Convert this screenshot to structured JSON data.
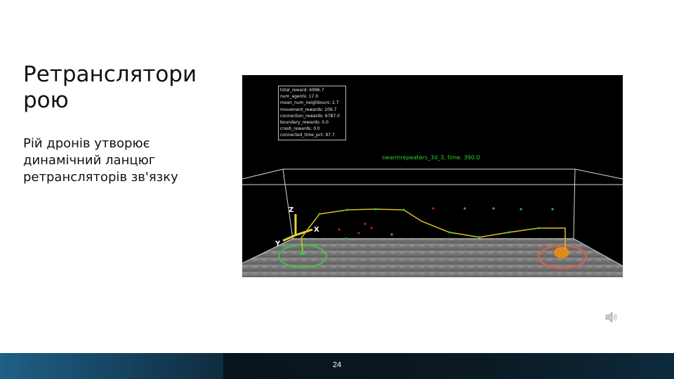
{
  "slide": {
    "title_lines": [
      "Ретранслятори",
      "рою"
    ],
    "body_lines": [
      "Рій дронів утворює",
      "динамічний ланцюг",
      "ретрансляторів зв'язку"
    ],
    "page_number": "24"
  },
  "simulation": {
    "title": "swarmrepeaters_3d_3, time: 390.0",
    "stats": [
      "total_reward: 6996.7",
      "num_agents: 17.0",
      "mean_num_neighbours: 2.7",
      "movement_rewards: 209.7",
      "connection_rewards: 6787.0",
      "boundary_rewards: 0.0",
      "crash_rewards: 0.0",
      "connected_time_pct: 97.7"
    ],
    "axis_labels": {
      "x": "X",
      "y": "Y",
      "z": "Z"
    },
    "colors": {
      "chain": "#d9c21f",
      "start_ring": "#3ec34a",
      "goal_ring": "#e85a4a",
      "agent_green": "#2bbf2b",
      "agent_red": "#c0201c"
    }
  },
  "icons": {
    "audio": "speaker-icon"
  }
}
